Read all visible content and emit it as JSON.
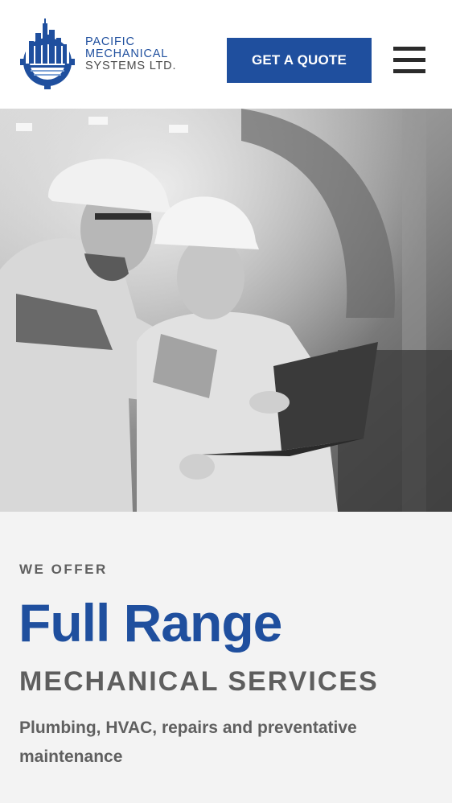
{
  "header": {
    "logo_lines": [
      "PACIFIC",
      "MECHANICAL",
      "SYSTEMS LTD."
    ],
    "cta_label": "GET A QUOTE",
    "menu_icon": "hamburger-icon"
  },
  "hero": {
    "image": "photo-engineers-with-laptop"
  },
  "offer": {
    "eyebrow": "WE OFFER",
    "headline": "Full Range",
    "subheadline": "MECHANICAL SERVICES",
    "description": "Plumbing, HVAC, repairs and preventative maintenance"
  },
  "colors": {
    "brand_blue": "#1f4f9e",
    "text_gray": "#5f5f5f",
    "background": "#f3f3f3"
  }
}
